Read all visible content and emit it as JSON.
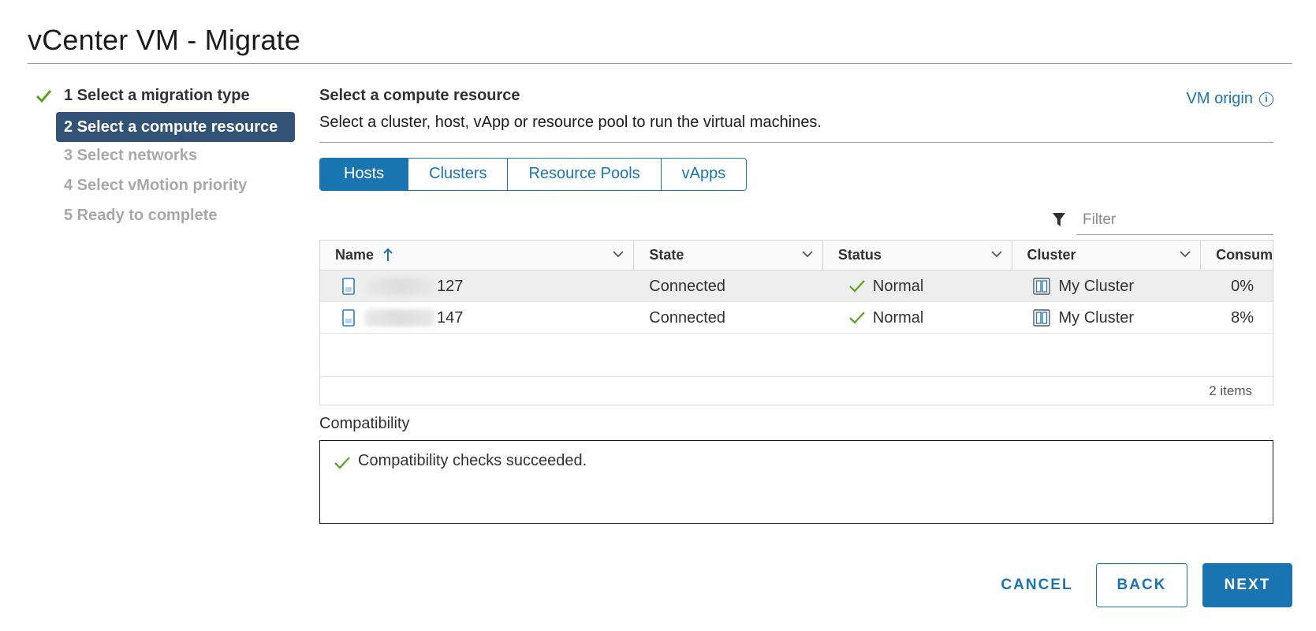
{
  "window": {
    "title": "vCenter VM - Migrate"
  },
  "steps": [
    {
      "label": "1 Select a migration type",
      "state": "done"
    },
    {
      "label": "2 Select a compute resource",
      "state": "active"
    },
    {
      "label": "3 Select networks",
      "state": "pending"
    },
    {
      "label": "4 Select vMotion priority",
      "state": "pending"
    },
    {
      "label": "5 Ready to complete",
      "state": "pending"
    }
  ],
  "main": {
    "title": "Select a compute resource",
    "description": "Select a cluster, host, vApp or resource pool to run the virtual machines.",
    "vm_origin_label": "VM origin",
    "info_icon": "i"
  },
  "tabs": [
    {
      "label": "Hosts",
      "active": true
    },
    {
      "label": "Clusters",
      "active": false
    },
    {
      "label": "Resource Pools",
      "active": false
    },
    {
      "label": "vApps",
      "active": false
    }
  ],
  "filter": {
    "placeholder": "Filter"
  },
  "grid": {
    "columns": [
      "Name",
      "State",
      "Status",
      "Cluster",
      "Consum"
    ],
    "rows": [
      {
        "name_suffix": "127",
        "state": "Connected",
        "status": "Normal",
        "cluster": "My Cluster",
        "consumed": "0%"
      },
      {
        "name_suffix": "147",
        "state": "Connected",
        "status": "Normal",
        "cluster": "My Cluster",
        "consumed": "8%"
      }
    ],
    "footer": "2 items"
  },
  "compatibility": {
    "label": "Compatibility",
    "message": "Compatibility checks succeeded."
  },
  "buttons": {
    "cancel": "CANCEL",
    "back": "BACK",
    "next": "NEXT"
  },
  "colors": {
    "accent": "#1a74b0",
    "active_step": "#325276",
    "success": "#5aa220"
  }
}
